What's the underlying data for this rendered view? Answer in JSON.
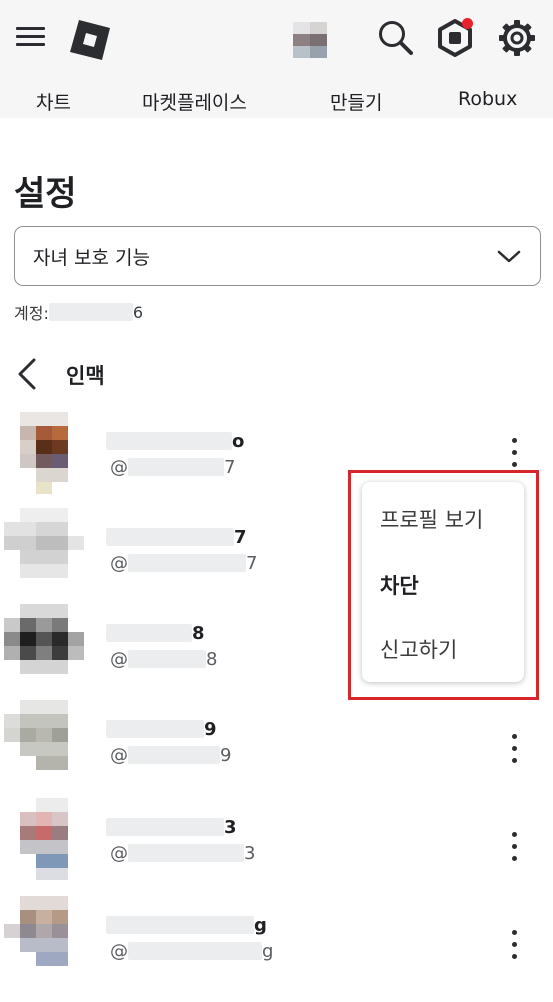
{
  "header": {
    "logo_icon": "roblox-logo-icon",
    "menu_icon": "hamburger-menu-icon",
    "search_icon": "search-icon",
    "robux_icon": "robux-icon",
    "settings_icon": "gear-icon",
    "notification_color": "#e8222c"
  },
  "nav": {
    "items": [
      {
        "label": "차트"
      },
      {
        "label": "마켓플레이스"
      },
      {
        "label": "만들기"
      },
      {
        "label": "Robux"
      }
    ]
  },
  "page": {
    "title": "설정",
    "select_value": "자녀 보호 기능",
    "account_label": "계정:",
    "account_suffix": "6"
  },
  "section": {
    "title": "인맥"
  },
  "connections": [
    {
      "name_suffix": "o",
      "handle_prefix": "@",
      "handle_suffix": "7"
    },
    {
      "name_suffix": "7",
      "handle_prefix": "@",
      "handle_suffix": "7"
    },
    {
      "name_suffix": "8",
      "handle_prefix": "@",
      "handle_suffix": "8"
    },
    {
      "name_suffix": "9",
      "handle_prefix": "@",
      "handle_suffix": "9"
    },
    {
      "name_suffix": "3",
      "handle_prefix": "@",
      "handle_suffix": "3"
    },
    {
      "name_suffix": "g",
      "handle_prefix": "@",
      "handle_suffix": "g"
    }
  ],
  "context_menu": {
    "items": [
      {
        "label": "프로필 보기"
      },
      {
        "label": "차단"
      },
      {
        "label": "신고하기"
      }
    ],
    "highlight_color": "#d6262c"
  }
}
